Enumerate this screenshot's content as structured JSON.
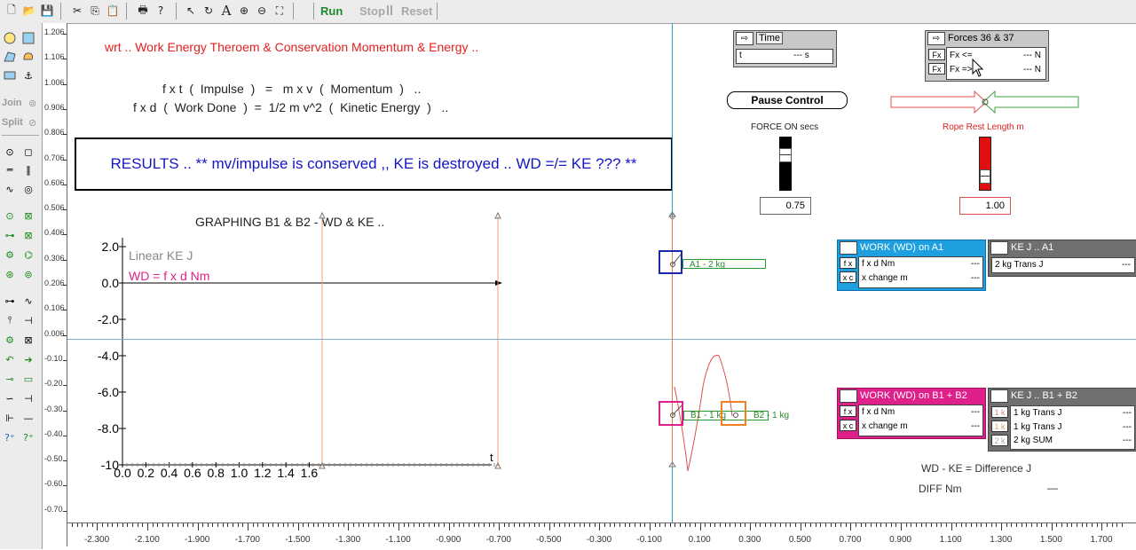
{
  "toolbar": {
    "run": "Run",
    "stop": "Stop",
    "reset": "Reset"
  },
  "leftbar": {
    "join": "Join",
    "split": "Split"
  },
  "header": {
    "title": "wrt .. Work Energy Theroem & Conservation Momentum & Energy ..",
    "eq1": "f x t  (  Impulse  )   =   m x v  (  Momentum  )   ..",
    "eq2": "f x d  (  Work Done  )  =  1/2 m v^2  (  Kinetic Energy  )   .."
  },
  "results": "RESULTS .. ** mv/impulse is conserved ,, KE is destroyed .. WD =/= KE ??? **",
  "graph": {
    "title": "GRAPHING B1 & B2 - WD & KE ..",
    "legend_ke": "Linear KE J",
    "legend_wd": "WD = f x d Nm",
    "xaxis_label": "t",
    "yticks": [
      "2.0",
      "0.0",
      "-2.0",
      "-4.0",
      "-6.0",
      "-8.0",
      "-10"
    ],
    "xticks": [
      "0.0",
      "0.2",
      "0.4",
      "0.6",
      "0.8",
      "1.0",
      "1.2",
      "1.4",
      "1.6"
    ]
  },
  "vruler": [
    "1.206",
    "1.106",
    "1.006",
    "0.906",
    "0.806",
    "0.706",
    "0.606",
    "0.506",
    "0.406",
    "0.306",
    "0.206",
    "0.106",
    "0.006",
    "-0.10",
    "-0.20",
    "-0.30",
    "-0.40",
    "-0.50",
    "-0.60",
    "-0.70"
  ],
  "hruler": [
    "-2.300",
    "-2.100",
    "-1.900",
    "-1.700",
    "-1.500",
    "-1.300",
    "-1.100",
    "-0.900",
    "-0.700",
    "-0.500",
    "-0.300",
    "-0.100",
    "0.100",
    "0.300",
    "0.500",
    "0.700",
    "0.900",
    "1.100",
    "1.300",
    "1.500",
    "1.700"
  ],
  "time_panel": {
    "title": "Time",
    "var": "t",
    "value": "--- s"
  },
  "forces_panel": {
    "title": "Forces 36 & 37",
    "r1": "Fx <=",
    "r1v": "--- N",
    "r2": "Fx =>",
    "r2v": "--- N",
    "icon": "Fx"
  },
  "pause": "Pause Control",
  "force_on": {
    "label": "FORCE ON secs",
    "value": "0.75"
  },
  "rope": {
    "label": "Rope Rest Length m",
    "value": "1.00"
  },
  "bodies": {
    "a1": "A1 - 2 kg",
    "b1": "B1 - 1 kg",
    "b2": "B2 - 1 kg"
  },
  "wd_a1": {
    "title": "WORK (WD) on A1",
    "r1": "f x d Nm",
    "r2": "x change m",
    "i1": "f x",
    "i2": "x c",
    "v": "---"
  },
  "ke_a1": {
    "title": "KE J .. A1",
    "r1": "2 kg Trans J",
    "v": "---"
  },
  "wd_b": {
    "title": "WORK (WD) on B1 + B2",
    "r1": "f x d Nm",
    "r2": "x change m",
    "i1": "f x",
    "i2": "x c",
    "v": "---"
  },
  "ke_b": {
    "title": "KE J .. B1 + B2",
    "r1": "1 kg Trans J",
    "r2": "1 kg Trans J",
    "r3": "2 kg SUM",
    "i1": "1 k",
    "i2": "1 k",
    "i3": "2 k",
    "v": "---"
  },
  "diff": {
    "l1": "WD - KE = Difference J",
    "l2": "DIFF Nm",
    "v": "—"
  },
  "colors": {
    "blue_text": "#1515c8",
    "red_title": "#e02020",
    "a1_blue": "#2a7fd0",
    "b_magenta": "#e0208a",
    "grey_panel": "#707070"
  }
}
